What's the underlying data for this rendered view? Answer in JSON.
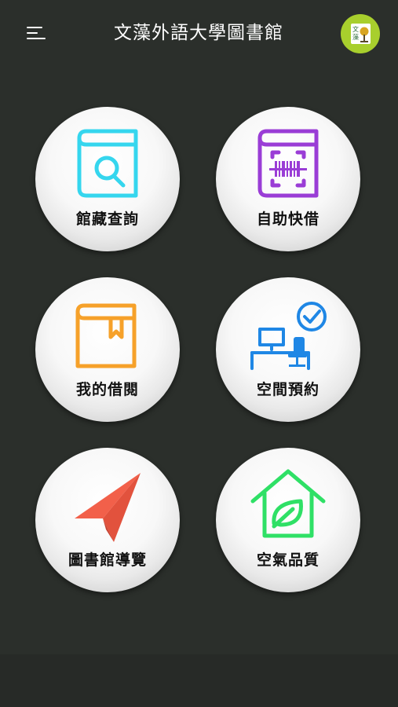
{
  "header": {
    "menu_icon": "hamburger-menu-icon",
    "title": "文藻外語大學圖書館",
    "logo_chars": [
      "文",
      "藻"
    ]
  },
  "tiles": [
    {
      "label": "館藏查詢",
      "icon": "book-search-icon",
      "color": "#35d6ee"
    },
    {
      "label": "自助快借",
      "icon": "book-barcode-icon",
      "color": "#9a3dd6"
    },
    {
      "label": "我的借閱",
      "icon": "bookmark-book-icon",
      "color": "#f6a12a"
    },
    {
      "label": "空間預約",
      "icon": "desk-check-icon",
      "color": "#1f87e5"
    },
    {
      "label": "圖書館導覽",
      "icon": "paper-plane-icon",
      "color": "#f2604a"
    },
    {
      "label": "空氣品質",
      "icon": "house-leaf-icon",
      "color": "#2fe066"
    }
  ],
  "colors": {
    "background": "#2b2f2b",
    "logo_green": "#a8cf2d"
  }
}
